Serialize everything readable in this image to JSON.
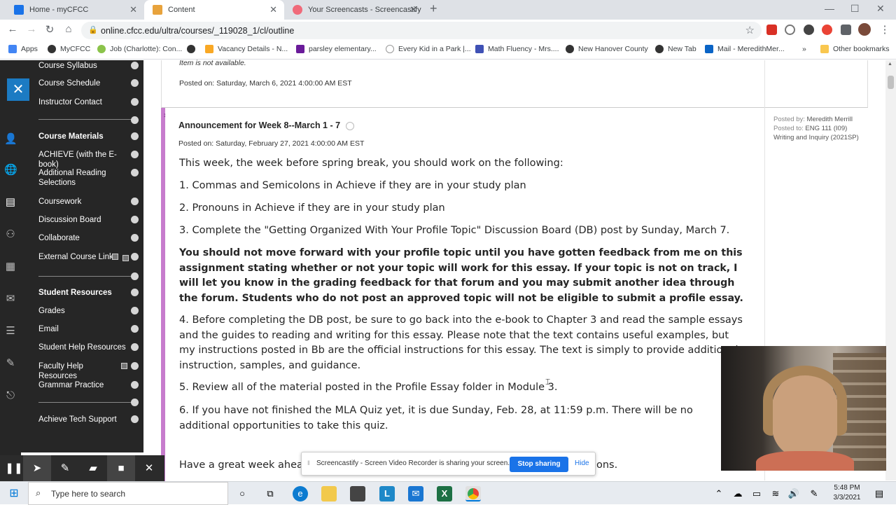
{
  "browser": {
    "tabs": [
      {
        "label": "Home - myCFCC",
        "color": "#1a73e8"
      },
      {
        "label": "Content",
        "color": "#e8a33c"
      },
      {
        "label": "Your Screencasts - Screencastify",
        "color": "#f06a7a"
      }
    ],
    "new_tab": "+",
    "url": "online.cfcc.edu/ultra/courses/_119028_1/cl/outline",
    "bookmarks": [
      {
        "label": "Apps"
      },
      {
        "label": "MyCFCC"
      },
      {
        "label": "Job (Charlotte): Con..."
      },
      {
        "label": ""
      },
      {
        "label": "Vacancy Details - N..."
      },
      {
        "label": "parsley elementary..."
      },
      {
        "label": "Every Kid in a Park |..."
      },
      {
        "label": "Math Fluency - Mrs...."
      },
      {
        "label": "New Hanover County"
      },
      {
        "label": "New Tab"
      },
      {
        "label": "Mail - MeredithMer..."
      },
      {
        "label": "»"
      },
      {
        "label": "Other bookmarks"
      }
    ]
  },
  "course_nav": {
    "close": "✕",
    "items": [
      {
        "label": "Course Syllabus",
        "bold": false
      },
      {
        "label": "Course Schedule",
        "bold": false
      },
      {
        "label": "Instructor Contact",
        "bold": false
      },
      {
        "label": "Course Materials",
        "bold": true
      },
      {
        "label": "ACHIEVE (with the E-book)",
        "bold": false
      },
      {
        "label": "Additional Reading Selections",
        "bold": false
      },
      {
        "label": "Coursework",
        "bold": false
      },
      {
        "label": "Discussion Board",
        "bold": false
      },
      {
        "label": "Collaborate",
        "bold": false
      },
      {
        "label": "External Course Link",
        "bold": false
      },
      {
        "label": "Student Resources",
        "bold": true
      },
      {
        "label": "Grades",
        "bold": false
      },
      {
        "label": "Email",
        "bold": false
      },
      {
        "label": "Student Help Resources",
        "bold": false
      },
      {
        "label": "Faculty Help Resources",
        "bold": false
      },
      {
        "label": "Grammar Practice",
        "bold": false
      },
      {
        "label": "Achieve Tech Support",
        "bold": false
      }
    ]
  },
  "prev_item": {
    "note": "Item is not available.",
    "posted": "Posted on: Saturday, March 6, 2021 4:00:00 AM EST"
  },
  "announcement": {
    "title": "Announcement for Week 8--March 1 - 7",
    "posted": "Posted on: Saturday, February 27, 2021 4:00:00 AM EST",
    "meta_posted_by_label": "Posted by:",
    "meta_posted_by": "Meredith Merrill",
    "meta_posted_to_label": "Posted to:",
    "meta_posted_to": "ENG 111 (I09)",
    "meta_course": "Writing and Inquiry (2021SP)",
    "intro": "This week, the week before spring break, you should work on the following:",
    "item1": "1. Commas and Semicolons in Achieve if they are in your study plan",
    "item2": "2. Pronouns in Achieve if they are in your study plan",
    "item3": "3. Complete the \"Getting Organized With Your Profile Topic\" Discussion Board (DB) post by Sunday, March 7.",
    "bold_para": "You should not move forward with your profile topic until you have gotten feedback from me on this assignment stating whether or not your topic will work for this essay. If your topic is not on track, I will let you know in the grading feedback for that forum and you may submit another idea through the forum. Students who do not post an approved topic will not be eligible to submit a profile essay.",
    "item4": "4. Before completing the DB post, be sure to go back into the e-book to Chapter 3 and read the sample essays and the guides to reading and writing for this essay. Please note that the text contains useful examples, but my instructions posted in Bb are the official instructions for this essay. The text is simply to provide additional instruction, samples, and guidance.",
    "item5": "5. Review all of the material posted in the Profile Essay folder in Module 3.",
    "item6": "6. If you have not finished the MLA Quiz yet, it is due Sunday, Feb. 28, at 11:59 p.m. There will be no additional opportunities to take this quiz.",
    "closing_start": "Have a great week ahea",
    "closing_end": "ons."
  },
  "screencastify": {
    "message": "Screencastify - Screen Video Recorder is sharing your screen.",
    "stop": "Stop sharing",
    "hide": "Hide"
  },
  "taskbar": {
    "search_placeholder": "Type here to search",
    "time": "5:48 PM",
    "date": "3/3/2021"
  }
}
